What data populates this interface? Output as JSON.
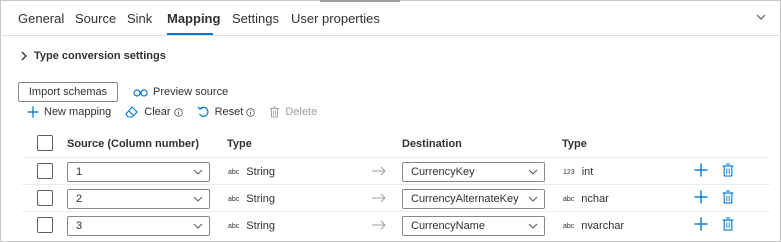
{
  "tabs": [
    {
      "label": "General",
      "active": false
    },
    {
      "label": "Source",
      "active": false
    },
    {
      "label": "Sink",
      "active": false
    },
    {
      "label": "Mapping",
      "active": true
    },
    {
      "label": "Settings",
      "active": false
    },
    {
      "label": "User properties",
      "active": false
    }
  ],
  "type_conversion": {
    "label": "Type conversion settings",
    "expanded": false
  },
  "actions": {
    "import_schemas": "Import schemas",
    "preview_source": "Preview source"
  },
  "toolbar": {
    "new_mapping": "New mapping",
    "clear": "Clear",
    "reset": "Reset",
    "delete": "Delete"
  },
  "columns": {
    "source": "Source (Column number)",
    "type": "Type",
    "destination": "Destination",
    "dest_type": "Type"
  },
  "rows": [
    {
      "source": "1",
      "source_type_glyph": "abc",
      "source_type": "String",
      "destination": "CurrencyKey",
      "dest_type_glyph": "123",
      "dest_type": "int"
    },
    {
      "source": "2",
      "source_type_glyph": "abc",
      "source_type": "String",
      "destination": "CurrencyAlternateKey",
      "dest_type_glyph": "abc",
      "dest_type": "nchar"
    },
    {
      "source": "3",
      "source_type_glyph": "abc",
      "source_type": "String",
      "destination": "CurrencyName",
      "dest_type_glyph": "abc",
      "dest_type": "nvarchar"
    }
  ],
  "colors": {
    "accent": "#0078d4",
    "border": "#8a8886",
    "text": "#323130",
    "disabled": "#a19f9d"
  },
  "icons": {
    "collapse": "chevron-up-icon",
    "section": "chevron-right-icon",
    "preview": "glasses-icon",
    "new": "plus-icon",
    "clear": "eraser-icon",
    "reset": "undo-icon",
    "delete": "trash-icon",
    "info": "info-icon",
    "row_arrow": "arrow-right-icon",
    "dropdown": "chevron-down-icon"
  }
}
